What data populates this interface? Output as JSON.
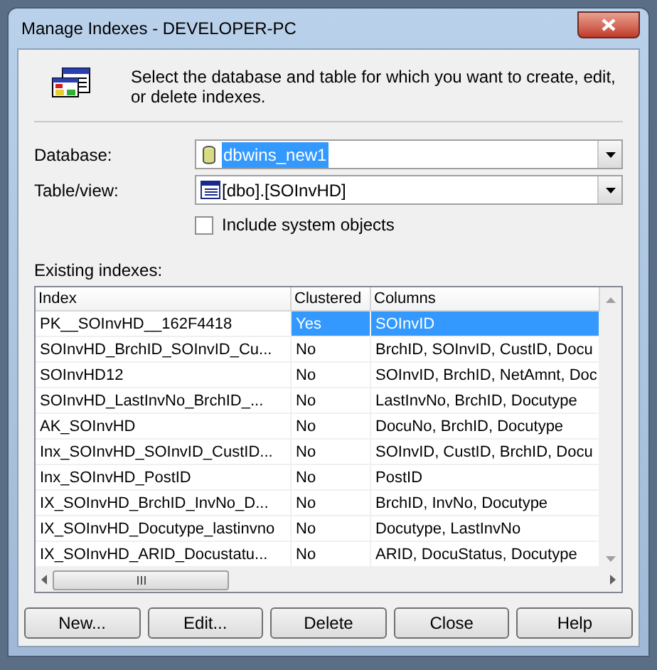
{
  "window": {
    "title": "Manage Indexes - DEVELOPER-PC"
  },
  "intro": "Select the database and table for which you want to create, edit, or delete indexes.",
  "database": {
    "label": "Database:",
    "value": "dbwins_new1"
  },
  "table_view": {
    "label": "Table/view:",
    "value": "[dbo].[SOInvHD]"
  },
  "include_system_objects": {
    "label": "Include system objects",
    "checked": false
  },
  "indexes": {
    "label": "Existing indexes:",
    "columns": [
      "Index",
      "Clustered",
      "Columns"
    ],
    "rows": [
      {
        "cells": [
          "PK__SOInvHD__162F4418",
          "Yes",
          "SOInvID"
        ],
        "selected": true
      },
      {
        "cells": [
          "SOInvHD_BrchID_SOInvID_Cu...",
          "No",
          "BrchID, SOInvID, CustID, Docu"
        ],
        "selected": false
      },
      {
        "cells": [
          "SOInvHD12",
          "No",
          "SOInvID, BrchID, NetAmnt, Doc"
        ],
        "selected": false
      },
      {
        "cells": [
          "SOInvHD_LastInvNo_BrchID_...",
          "No",
          "LastInvNo, BrchID, Docutype"
        ],
        "selected": false
      },
      {
        "cells": [
          "AK_SOInvHD",
          "No",
          "DocuNo, BrchID, Docutype"
        ],
        "selected": false
      },
      {
        "cells": [
          "Inx_SOInvHD_SOInvID_CustID...",
          "No",
          "SOInvID, CustID, BrchID, Docu"
        ],
        "selected": false
      },
      {
        "cells": [
          "Inx_SOInvHD_PostID",
          "No",
          "PostID"
        ],
        "selected": false
      },
      {
        "cells": [
          "IX_SOInvHD_BrchID_InvNo_D...",
          "No",
          "BrchID, InvNo, Docutype"
        ],
        "selected": false
      },
      {
        "cells": [
          "IX_SOInvHD_Docutype_lastinvno",
          "No",
          "Docutype, LastInvNo"
        ],
        "selected": false
      },
      {
        "cells": [
          "IX_SOInvHD_ARID_Docustatu...",
          "No",
          "ARID, DocuStatus, Docutype"
        ],
        "selected": false
      }
    ]
  },
  "buttons": [
    "New...",
    "Edit...",
    "Delete",
    "Close",
    "Help"
  ]
}
